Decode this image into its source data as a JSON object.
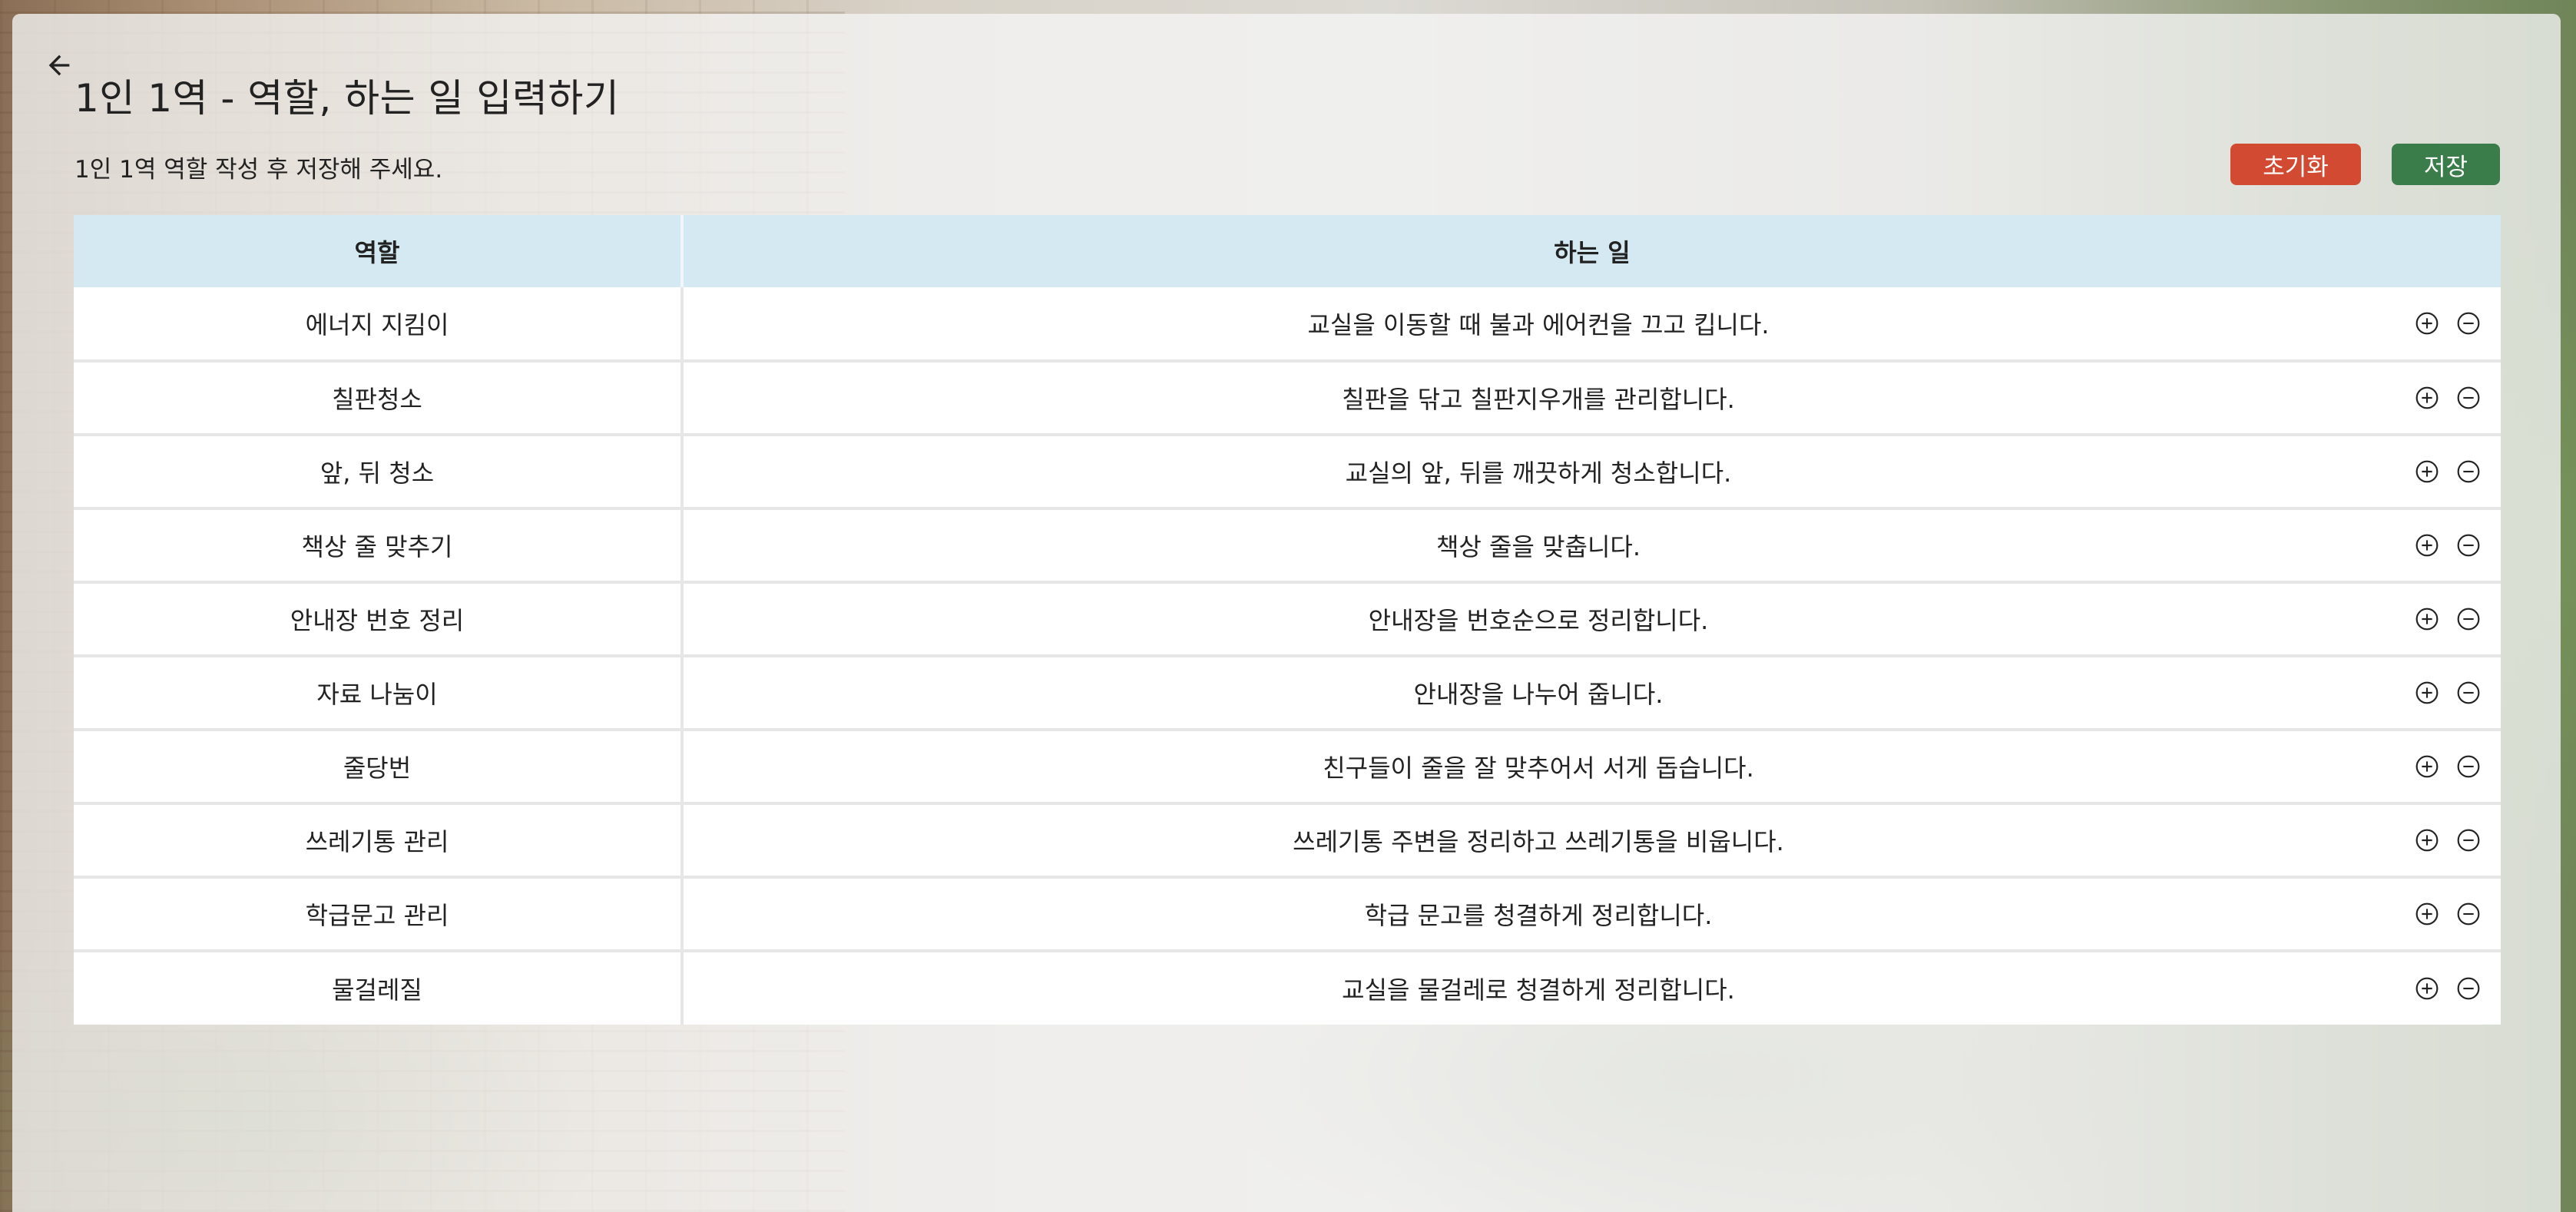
{
  "page": {
    "title": "1인 1역 - 역할, 하는 일 입력하기",
    "subtitle": "1인 1역 역할 작성 후 저장해 주세요."
  },
  "icons": {
    "back": "arrow-left-icon",
    "add": "plus-circle-icon",
    "remove": "minus-circle-icon"
  },
  "buttons": {
    "reset_label": "초기화",
    "save_label": "저장"
  },
  "colors": {
    "reset": "#d24a32",
    "save": "#3b7d4a",
    "header_bg": "#d4e9f1"
  },
  "table": {
    "headers": {
      "role": "역할",
      "task": "하는 일"
    },
    "rows": [
      {
        "role": "에너지 지킴이",
        "task": "교실을 이동할 때 불과 에어컨을 끄고 킵니다."
      },
      {
        "role": "칠판청소",
        "task": "칠판을 닦고 칠판지우개를 관리합니다."
      },
      {
        "role": "앞, 뒤 청소",
        "task": "교실의 앞, 뒤를 깨끗하게 청소합니다."
      },
      {
        "role": "책상 줄 맞추기",
        "task": "책상 줄을 맞춥니다."
      },
      {
        "role": "안내장 번호 정리",
        "task": "안내장을 번호순으로 정리합니다."
      },
      {
        "role": "자료 나눔이",
        "task": "안내장을 나누어 줍니다."
      },
      {
        "role": "줄당번",
        "task": "친구들이 줄을 잘 맞추어서 서게 돕습니다."
      },
      {
        "role": "쓰레기통 관리",
        "task": "쓰레기통 주변을 정리하고 쓰레기통을 비웁니다."
      },
      {
        "role": "학급문고 관리",
        "task": "학급 문고를 청결하게 정리합니다."
      },
      {
        "role": "물걸레질",
        "task": "교실을 물걸레로 청결하게 정리합니다."
      }
    ]
  }
}
